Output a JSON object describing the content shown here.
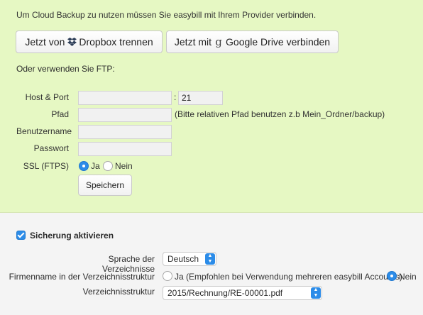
{
  "intro": "Um Cloud Backup zu nutzen müssen Sie easybill mit Ihrem Provider verbinden.",
  "buttons": {
    "dropbox_prefix": "Jetzt von",
    "dropbox_suffix": "Dropbox trennen",
    "gdrive_prefix": "Jetzt mit",
    "gdrive_suffix": "Google Drive verbinden"
  },
  "ftp_label": "Oder verwenden Sie FTP:",
  "ftp": {
    "host_label": "Host & Port",
    "host_value": "",
    "port_sep": ":",
    "port_value": "21",
    "path_label": "Pfad",
    "path_value": "",
    "path_hint": "(Bitte relativen Pfad benutzen z.b Mein_Ordner/backup)",
    "user_label": "Benutzername",
    "user_value": "",
    "pass_label": "Passwort",
    "pass_value": "",
    "ssl_label": "SSL (FTPS)",
    "ssl_yes": "Ja",
    "ssl_no": "Nein",
    "ssl_selected": "Ja",
    "save_label": "Speichern"
  },
  "backup": {
    "enable_label": "Sicherung aktivieren",
    "enabled": true,
    "language_label": "Sprache der Verzeichnisse",
    "language_value": "Deutsch",
    "company_label": "Firmenname in der Verzeichnisstruktur",
    "company_yes": "Ja (Empfohlen bei Verwendung mehreren easybill Accounts)",
    "company_no": "Nein",
    "company_selected": "Nein",
    "structure_label": "Verzeichnisstruktur",
    "structure_value": "2015/Rechnung/RE-00001.pdf"
  },
  "colors": {
    "accent": "#2c8ce8",
    "panel": "#e6f8c3",
    "dropbox": "#2c3d57"
  }
}
